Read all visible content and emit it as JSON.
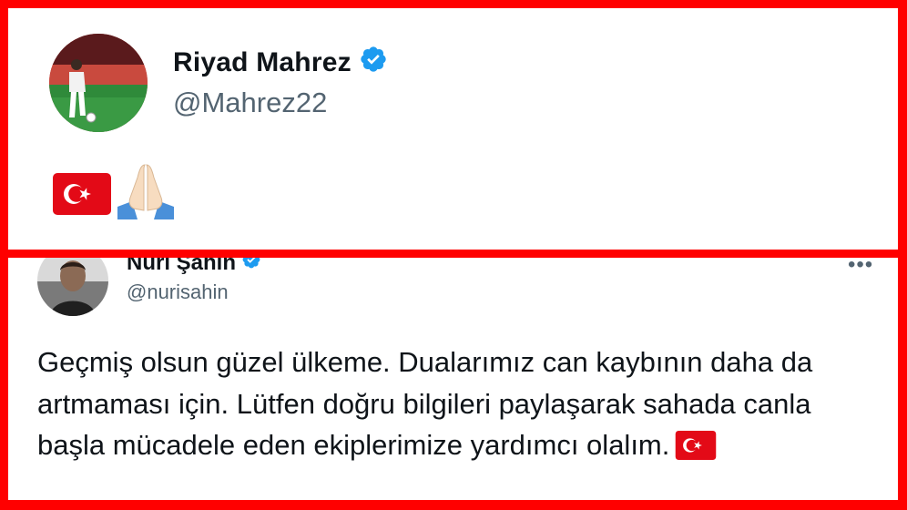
{
  "tweets": [
    {
      "name": "Riyad Mahrez",
      "handle": "@Mahrez22",
      "verified": true,
      "body_emojis": [
        "turkey-flag",
        "folded-hands"
      ]
    },
    {
      "name": "Nuri Şahin",
      "handle": "@nurisahin",
      "verified": true,
      "text": "Geçmiş olsun güzel ülkeme. Dualarımız can kaybının daha da artmaması için. Lütfen doğru bilgileri paylaşarak sahada canla başla mücadele eden ekiplerimize yardımcı olalım.",
      "trailing_emoji": "turkey-flag",
      "more_label": "•••"
    }
  ],
  "colors": {
    "frame": "#ff0000",
    "name_text": "#0f1419",
    "handle_text": "#536471",
    "verified_blue": "#1d9bf0",
    "flag_red": "#e30a17"
  }
}
